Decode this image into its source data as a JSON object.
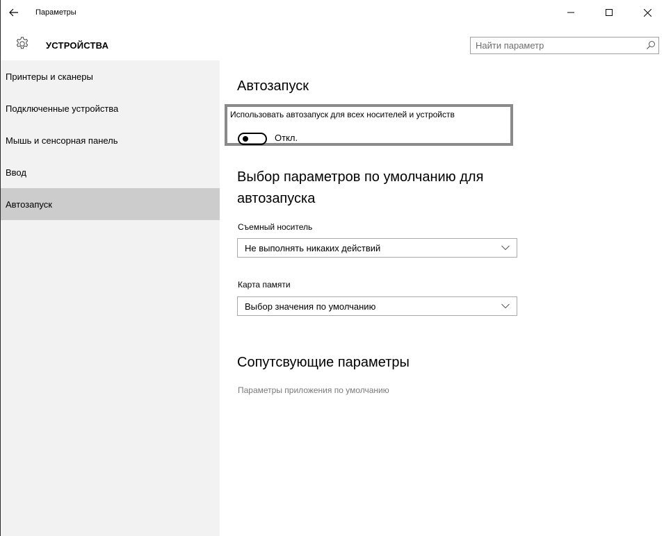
{
  "window": {
    "title": "Параметры",
    "back_icon": "arrow-left-icon",
    "controls": {
      "minimize": "–",
      "maximize": "☐",
      "close": "✕"
    }
  },
  "header": {
    "icon": "gear-icon",
    "title": "УСТРОЙСТВА",
    "search": {
      "placeholder": "Найти параметр",
      "value": "",
      "icon": "search-icon"
    }
  },
  "sidebar": {
    "items": [
      {
        "label": "Принтеры и сканеры",
        "active": false
      },
      {
        "label": "Подключенные устройства",
        "active": false
      },
      {
        "label": "Мышь и сенсорная панель",
        "active": false
      },
      {
        "label": "Ввод",
        "active": false
      },
      {
        "label": "Автозапуск",
        "active": true
      }
    ]
  },
  "main": {
    "autorun": {
      "title": "Автозапуск",
      "description": "Использовать автозапуск для всех носителей и устройств",
      "toggle_state": "Откл."
    },
    "defaults": {
      "title_line1": "Выбор параметров по умолчанию для",
      "title_line2": "автозапуска",
      "removable": {
        "label": "Съемный носитель",
        "value": "Не выполнять никаких действий"
      },
      "memory_card": {
        "label": "Карта памяти",
        "value": "Выбор значения по умолчанию"
      }
    },
    "related": {
      "title": "Сопутсвующие параметры",
      "link": "Параметры приложения по умолчанию"
    }
  },
  "colors": {
    "sidebar_bg": "#f2f2f2",
    "active_item_bg": "#cccccc",
    "highlight_border": "#8a8a8a",
    "link_gray": "#7a7a7a"
  }
}
